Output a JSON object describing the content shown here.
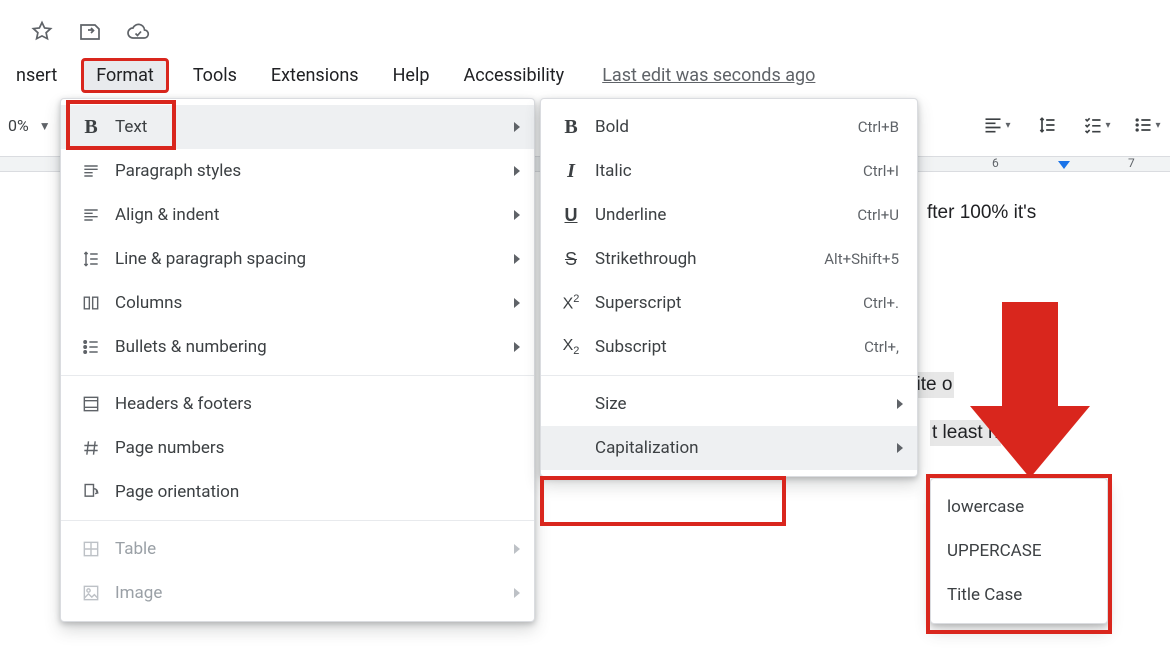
{
  "menubar": {
    "insert": "nsert",
    "format": "Format",
    "tools": "Tools",
    "extensions": "Extensions",
    "help": "Help",
    "accessibility": "Accessibility",
    "edit_note": "Last edit was seconds ago"
  },
  "toolbar": {
    "zoom": "0%"
  },
  "ruler": {
    "mark6": "6",
    "mark7": "7"
  },
  "doc": {
    "frag1": "fter 100% it's",
    "frag2": "site o",
    "frag3": "t least        n"
  },
  "format_menu": {
    "text": "Text",
    "paragraph_styles": "Paragraph styles",
    "align_indent": "Align & indent",
    "line_spacing": "Line & paragraph spacing",
    "columns": "Columns",
    "bullets_numbering": "Bullets & numbering",
    "headers_footers": "Headers & footers",
    "page_numbers": "Page numbers",
    "page_orientation": "Page orientation",
    "table": "Table",
    "image": "Image"
  },
  "text_menu": {
    "bold": "Bold",
    "bold_sc": "Ctrl+B",
    "italic": "Italic",
    "italic_sc": "Ctrl+I",
    "underline": "Underline",
    "underline_sc": "Ctrl+U",
    "strike": "Strikethrough",
    "strike_sc": "Alt+Shift+5",
    "superscript": "Superscript",
    "superscript_sc": "Ctrl+.",
    "subscript": "Subscript",
    "subscript_sc": "Ctrl+,",
    "size": "Size",
    "capitalization": "Capitalization"
  },
  "cap_menu": {
    "lowercase": "lowercase",
    "uppercase": "UPPERCASE",
    "titlecase": "Title Case"
  }
}
